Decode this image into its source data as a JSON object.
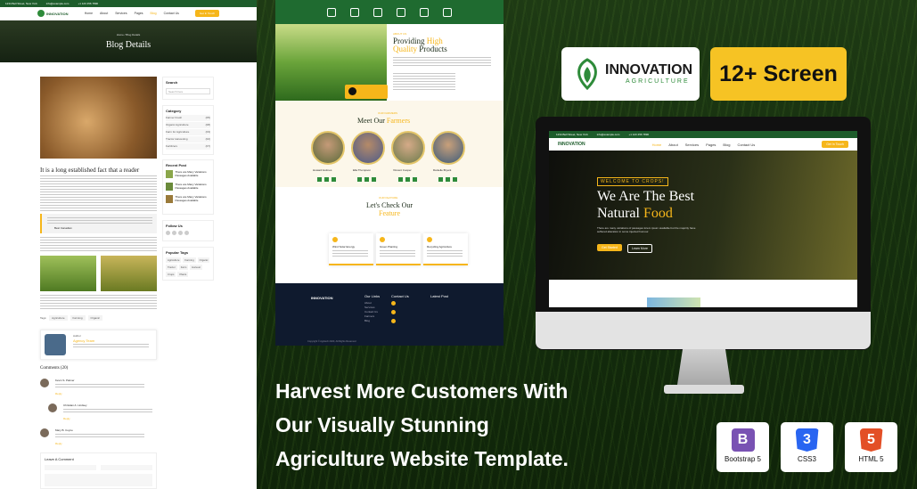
{
  "blog": {
    "topbar_address": "1234 Bell Street, New York",
    "topbar_email": "info@example.com",
    "topbar_phone": "+1 123 456 7890",
    "logo": "INNOVATION",
    "nav": [
      "Home",
      "About",
      "Services",
      "Pages",
      "Blog",
      "Contact Us"
    ],
    "nav_button": "Get In Touch",
    "hero_title": "Blog Details",
    "breadcrumb": "Home / Blog Details",
    "post_title": "It is a long established fact that a reader",
    "quote_author": "Best Canadian",
    "tags_label": "Tags:",
    "tags": [
      "Agriculture",
      "Farming",
      "Organic"
    ],
    "author_label": "Author",
    "author_name": "Agency Team",
    "comments_title": "Comments (20)",
    "commenters": [
      "Kevin S. Palmer",
      "Christian A. Lindsey",
      "Mary B. Coyne"
    ],
    "reply_label": "Reply",
    "leave_comment": "Leave A Comment",
    "sidebar": {
      "search_title": "Search",
      "search_placeholder": "Search here",
      "category_title": "Category",
      "categories": [
        "Farmer Fresh",
        "Organic Agriculture",
        "Farm for Agriculture",
        "Tractor Harvesting",
        "Fertilizers"
      ],
      "category_counts": [
        "(05)",
        "(08)",
        "(03)",
        "(02)",
        "(07)"
      ],
      "recent_title": "Recent Post",
      "recent_posts": [
        "There are Many Variations Passages Available",
        "There are Many Variations Passages Available",
        "There are Many Variations Passages Available"
      ],
      "follow_title": "Follow Us",
      "popular_tags_title": "Popular Tags",
      "popular_tags": [
        "Agriculture",
        "Farming",
        "Organic",
        "Tractor",
        "Farm",
        "Harvest",
        "Crops",
        "Plants"
      ]
    }
  },
  "middle": {
    "providing_sub": "ABOUT US",
    "providing_title_a": "Providing",
    "providing_title_b": "High",
    "providing_title_c": "Quality",
    "providing_title_d": "Products",
    "farmers_sub": "OUR FARMERS",
    "farmers_title_a": "Meet Our",
    "farmers_title_b": "Farmers",
    "farmer_names": [
      "Howard Holmes",
      "Ella Thompson",
      "Vincent Cooper",
      "Danielle Bryant"
    ],
    "farmer_role": "Farmer",
    "feature_sub": "OUR FEATURE",
    "feature_title_a": "Let's Check Our",
    "feature_title_b": "Feature",
    "features": [
      "Wind Solar Energy",
      "Green Planting",
      "Recycling Agriculture"
    ],
    "footer_logo": "INNOVATION",
    "footer_cols": [
      "Our Links",
      "Contact Us",
      "Latest Post"
    ],
    "footer_links": [
      "About",
      "Services",
      "Contact Us",
      "Farmers",
      "Blog"
    ],
    "copyright": "Copyright © Agritech 2023, All Rights Reserved"
  },
  "brand": {
    "name": "INNOVATION",
    "sub": "AGRICULTURE"
  },
  "screen_badge": "12+ Screen",
  "monitor": {
    "topbar_address": "1234 Bell Street, New York",
    "topbar_email": "info@example.com",
    "topbar_phone": "+1 123 456 7890",
    "nav": [
      "Home",
      "About",
      "Services",
      "Pages",
      "Blog",
      "Contact Us"
    ],
    "nav_button": "Get In Touch",
    "welcome": "WELCOME TO CROPS!",
    "hero_line1": "We Are The Best",
    "hero_line2a": "Natural",
    "hero_line2b": "Food",
    "hero_text": "There are many variations of passages lorem ipsum available but the majority have suffered alteration in some injected humour.",
    "btn_primary": "Get Started",
    "btn_secondary": "Learn More"
  },
  "tagline": [
    "Harvest More Customers With",
    "Our Visually Stunning",
    "Agriculture Website Template."
  ],
  "tech": [
    "Bootstrap 5",
    "CSS3",
    "HTML 5"
  ],
  "colors": {
    "accent_yellow": "#f6b61a",
    "brand_green": "#1d5c2b",
    "bootstrap": "#7952b3",
    "css3": "#2965f1",
    "html5": "#e34f26"
  }
}
